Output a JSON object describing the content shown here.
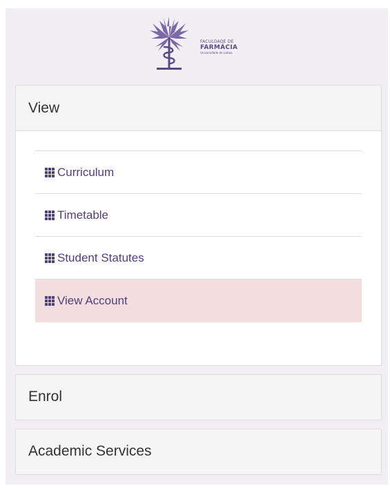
{
  "logo": {
    "line1": "FACULDADE DE",
    "line2": "FARMÁCIA",
    "line3": "Universidade de Lisboa",
    "icon": "palm-tree-caduceus-icon",
    "color": "#5b4a84"
  },
  "panels": {
    "view": {
      "title": "View",
      "expanded": true,
      "items": [
        {
          "label": "Curriculum",
          "icon": "grid-icon",
          "active": false
        },
        {
          "label": "Timetable",
          "icon": "grid-icon",
          "active": false
        },
        {
          "label": "Student Statutes",
          "icon": "grid-icon",
          "active": false
        },
        {
          "label": "View Account",
          "icon": "grid-icon",
          "active": true
        }
      ]
    },
    "enrol": {
      "title": "Enrol",
      "expanded": false
    },
    "academic_services": {
      "title": "Academic Services",
      "expanded": false
    }
  },
  "colors": {
    "link": "#4f3f7a",
    "active_background": "#f2dede",
    "sidebar_background": "#f1eff3"
  }
}
